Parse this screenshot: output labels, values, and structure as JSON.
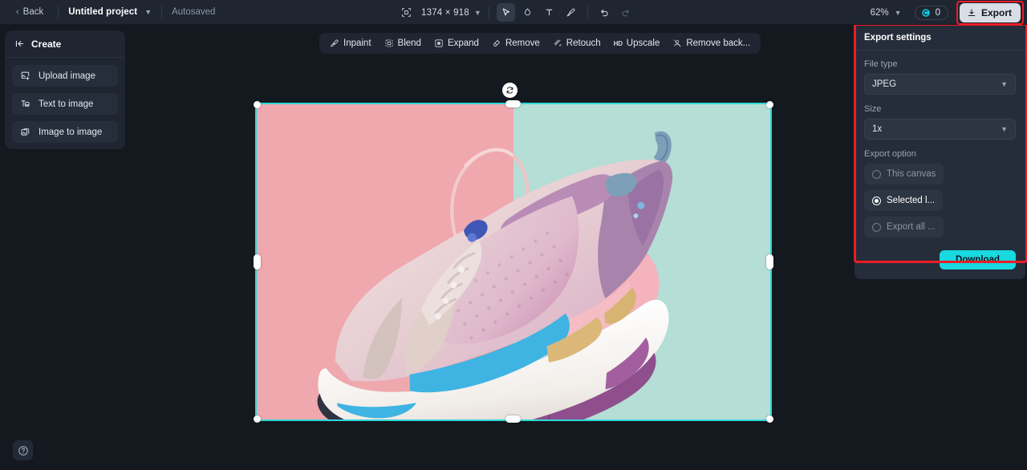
{
  "topbar": {
    "back_label": "Back",
    "project_name": "Untitled project",
    "autosaved_label": "Autosaved",
    "canvas_dimensions": "1374 × 918",
    "zoom_level": "62%",
    "credits_count": "0",
    "export_label": "Export",
    "tools": [
      {
        "name": "crop-icon",
        "label": "Crop"
      },
      {
        "name": "select-tool",
        "label": "Select",
        "active": true
      },
      {
        "name": "mask-tool",
        "label": "Mask"
      },
      {
        "name": "text-tool",
        "label": "T"
      },
      {
        "name": "brush-tool",
        "label": "Brush"
      },
      {
        "name": "undo-button",
        "label": "Undo"
      },
      {
        "name": "redo-button",
        "label": "Redo"
      }
    ]
  },
  "sidebar": {
    "title": "Create",
    "items": [
      {
        "label": "Upload image",
        "icon": "upload-image-icon"
      },
      {
        "label": "Text to image",
        "icon": "text-to-image-icon"
      },
      {
        "label": "Image to image",
        "icon": "image-to-image-icon"
      }
    ]
  },
  "canvas_toolbar": {
    "items": [
      {
        "label": "Inpaint",
        "icon": "inpaint-icon"
      },
      {
        "label": "Blend",
        "icon": "blend-icon"
      },
      {
        "label": "Expand",
        "icon": "expand-icon"
      },
      {
        "label": "Remove",
        "icon": "remove-icon"
      },
      {
        "label": "Retouch",
        "icon": "retouch-icon"
      },
      {
        "label": "Upscale",
        "icon": "hd-icon"
      },
      {
        "label": "Remove back...",
        "icon": "remove-background-icon"
      }
    ]
  },
  "canvas": {
    "selection_color": "#2fd8d8",
    "image_left_background": "#efa8ad",
    "image_right_background": "#b4ded6",
    "image_subject": "pastel pink sneaker"
  },
  "export_panel": {
    "title": "Export settings",
    "file_type_label": "File type",
    "file_type_value": "JPEG",
    "size_label": "Size",
    "size_value": "1x",
    "export_option_label": "Export option",
    "options": [
      {
        "label": "This canvas",
        "selected": false
      },
      {
        "label": "Selected l...",
        "selected": true
      },
      {
        "label": "Export all ...",
        "selected": false
      }
    ],
    "download_label": "Download",
    "accent_color": "#18d8e0",
    "highlight_color": "#ee1b24"
  },
  "help": {
    "icon": "help-icon",
    "label": "Help"
  }
}
